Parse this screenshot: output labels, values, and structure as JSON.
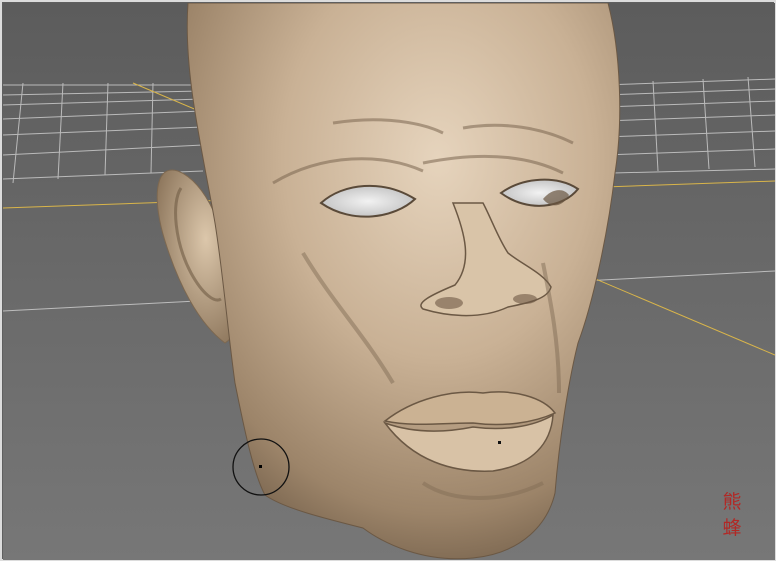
{
  "viewport": {
    "background_top": "#5c5c5c",
    "background_bottom": "#777777",
    "grid_color": "#d8d8d8",
    "axis_color": "#d9b54a"
  },
  "model": {
    "skin_base": "#c2aa8f",
    "skin_highlight": "#e6d4bd",
    "skin_shadow": "#6b5844"
  },
  "watermark": {
    "glyph_1": "熊",
    "glyph_2": "蜂",
    "color": "#b8211e"
  },
  "tools": {
    "brush_cursor": "brush-cursor-icon",
    "pivot_marker": "pivot-dot-icon"
  }
}
